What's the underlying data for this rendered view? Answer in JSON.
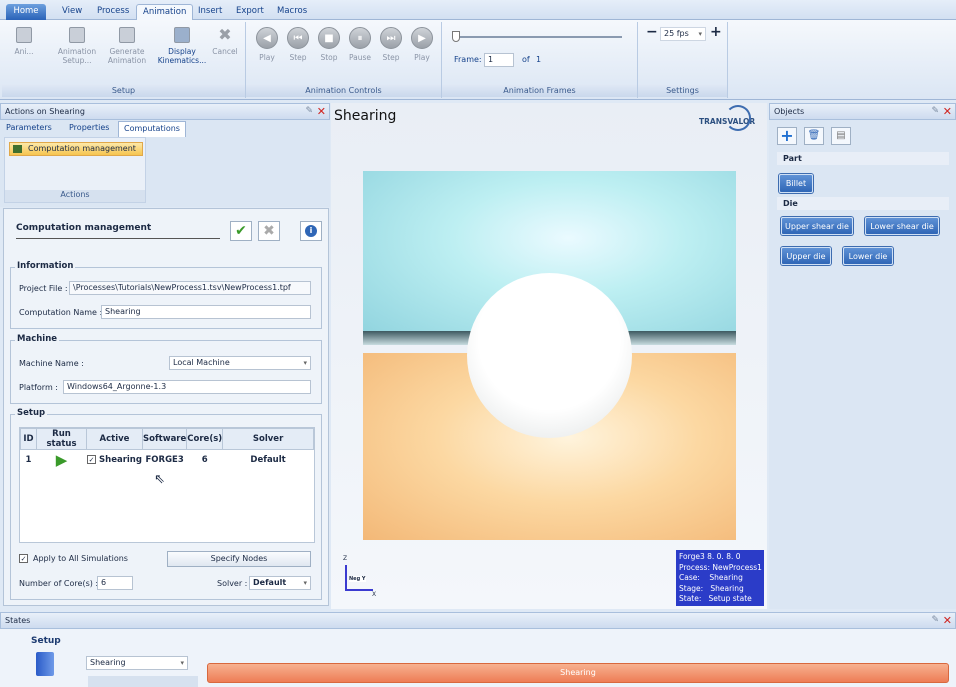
{
  "ribbon": {
    "tabs": [
      "Home",
      "View",
      "Process",
      "Animation",
      "Insert",
      "Export",
      "Macros"
    ],
    "active_tab": "Animation",
    "setup_group": {
      "label": "Setup",
      "buttons": [
        {
          "label": "Ani...",
          "icon": "animation-icon"
        },
        {
          "label": "Animation\nSetup...",
          "icon": "animation-setup-icon"
        },
        {
          "label": "Generate\nAnimation",
          "icon": "generate-animation-icon"
        },
        {
          "label": "Display\nKinematics...",
          "icon": "display-kinematics-icon"
        },
        {
          "label": "Cancel",
          "icon": "cancel-icon"
        }
      ]
    },
    "animation_controls": {
      "label": "Animation Controls",
      "buttons": [
        {
          "label": "Play",
          "glyph": "◀"
        },
        {
          "label": "Step",
          "glyph": "⏮"
        },
        {
          "label": "Stop",
          "glyph": "■"
        },
        {
          "label": "Pause",
          "glyph": "⏸"
        },
        {
          "label": "Step",
          "glyph": "⏭"
        },
        {
          "label": "Play",
          "glyph": "▶"
        }
      ]
    },
    "animation_frames": {
      "label": "Animation Frames",
      "frame_label": "Frame:",
      "frame_value": "1",
      "of_label": "of",
      "total_frames": "1",
      "slider_position": 0
    },
    "settings": {
      "label": "Settings",
      "minus": "−",
      "fps": "25 fps",
      "plus": "+"
    }
  },
  "actions_panel": {
    "title": "Actions on Shearing",
    "tabs": [
      "Parameters",
      "Properties",
      "Computations"
    ],
    "active_tab": "Computations",
    "computation_item": "Computation management",
    "actions_label": "Actions"
  },
  "computation": {
    "title": "Computation management",
    "information": {
      "legend": "Information",
      "project_file_label": "Project File :",
      "project_file_value": "\\Processes\\Tutorials\\NewProcess1.tsv\\NewProcess1.tpf",
      "computation_name_label": "Computation Name :",
      "computation_name_value": "Shearing"
    },
    "machine": {
      "legend": "Machine",
      "machine_name_label": "Machine Name :",
      "machine_name_value": "Local Machine",
      "platform_label": "Platform :",
      "platform_value": "Windows64_Argonne-1.3"
    },
    "setup": {
      "legend": "Setup",
      "columns": [
        "ID",
        "Run status",
        "Active",
        "Software",
        "Core(s)",
        "Solver"
      ],
      "rows": [
        {
          "id": "1",
          "run_status": "▶",
          "active": true,
          "name": "Shearing",
          "software": "FORGE3",
          "cores": "6",
          "solver": "Default"
        }
      ],
      "apply_all_label": "Apply to All Simulations",
      "apply_all_checked": true,
      "specify_nodes_label": "Specify Nodes",
      "cores_label": "Number of Core(s) :",
      "cores_value": "6",
      "solver_label": "Solver :",
      "solver_value": "Default"
    }
  },
  "viewport": {
    "title": "Shearing",
    "logo_text": "TRANSVALOR",
    "axis_label": "Neg Y",
    "axis_z": "Z",
    "axis_x": "X",
    "info_lines": [
      "Forge3 8. 0. 8. 0",
      "Process: NewProcess1",
      "Case:    Shearing",
      "Stage:   Shearing",
      "State:   Setup state"
    ]
  },
  "objects_panel": {
    "title": "Objects",
    "part_label": "Part",
    "billet_label": "Billet",
    "die_label": "Die",
    "dies": [
      "Upper shear die",
      "Lower shear die",
      "Upper die",
      "Lower die"
    ]
  },
  "states_panel": {
    "title": "States",
    "setup_label": "Setup",
    "dropdown_value": "Shearing",
    "timeline_label": "Shearing"
  },
  "colors": {
    "ribbon_blue": "#15428b",
    "accent_orange": "#f08a5d",
    "die_button": "#2f66b6",
    "info_box": "#2b3cc8"
  }
}
